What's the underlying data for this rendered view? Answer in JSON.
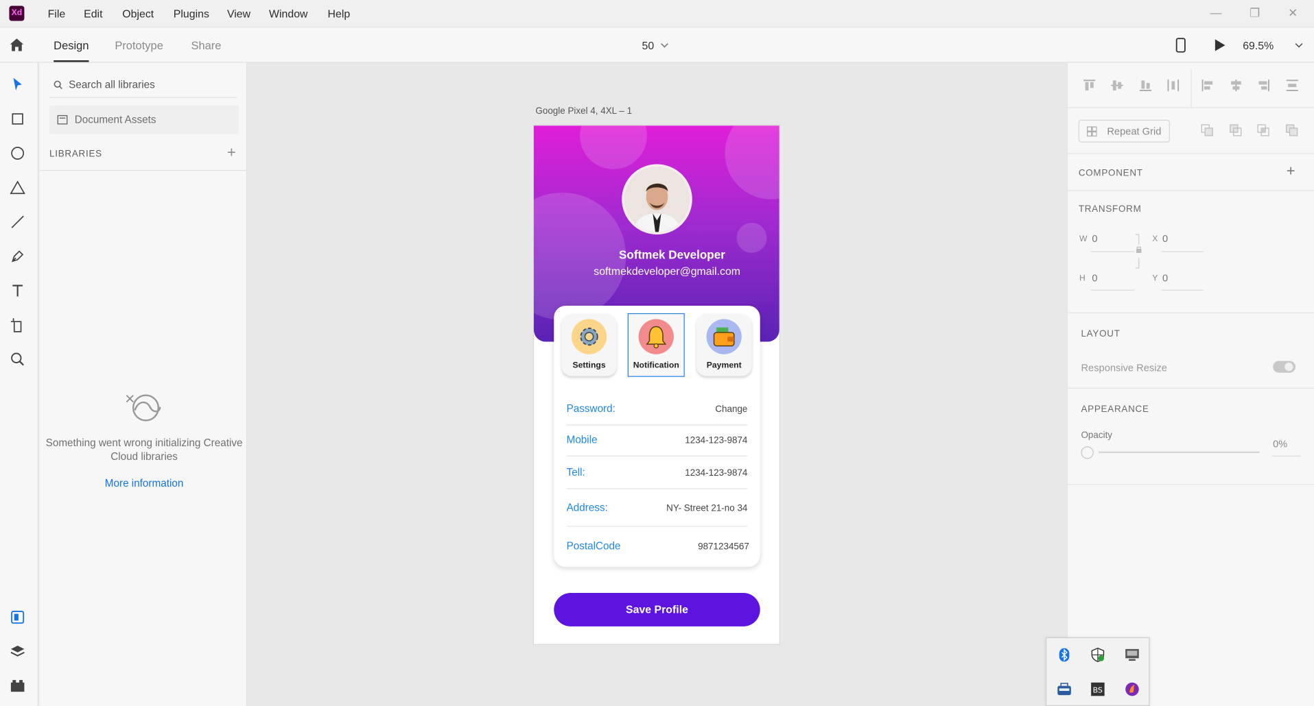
{
  "app": {
    "logo_text": "Xd",
    "menu": [
      "File",
      "Edit",
      "Object",
      "Plugins",
      "View",
      "Window",
      "Help"
    ]
  },
  "toolbar": {
    "tabs": [
      "Design",
      "Prototype",
      "Share"
    ],
    "active_tab": "Design",
    "grid_value": "50",
    "zoom": "69.5%"
  },
  "libraries": {
    "search_placeholder": "Search all libraries",
    "document_assets": "Document Assets",
    "header": "LIBRARIES",
    "error_message": "Something went wrong initializing Creative Cloud libraries",
    "more_info": "More information"
  },
  "artboard": {
    "label": "Google Pixel 4, 4XL – 1",
    "profile": {
      "name": "Softmek Developer",
      "email": "softmekdeveloper@gmail.com"
    },
    "tiles": [
      {
        "label": "Settings",
        "icon": "gear-icon"
      },
      {
        "label": "Notification",
        "icon": "bell-icon"
      },
      {
        "label": "Payment",
        "icon": "wallet-icon"
      }
    ],
    "rows": [
      {
        "key": "Password:",
        "value": "Change"
      },
      {
        "key": "Mobile",
        "value": "1234-123-9874"
      },
      {
        "key": "Tell:",
        "value": "1234-123-9874"
      },
      {
        "key": "Address:",
        "value": "NY- Street 21-no 34"
      },
      {
        "key": "PostalCode",
        "value": "9871234567"
      }
    ],
    "save_button": "Save Profile"
  },
  "properties": {
    "repeat_grid": "Repeat Grid",
    "component": "COMPONENT",
    "transform": "TRANSFORM",
    "w_label": "W",
    "w_value": "0",
    "x_label": "X",
    "x_value": "0",
    "h_label": "H",
    "h_value": "0",
    "y_label": "Y",
    "y_value": "0",
    "layout": "LAYOUT",
    "responsive_resize": "Responsive Resize",
    "appearance": "APPEARANCE",
    "opacity_label": "Opacity",
    "opacity_value": "0%"
  },
  "colors": {
    "accent": "#1473e6",
    "gradient_top": "#e01ed8",
    "gradient_bottom": "#5a22b4",
    "button": "#5e14e0",
    "row_key": "#1e88e5"
  }
}
